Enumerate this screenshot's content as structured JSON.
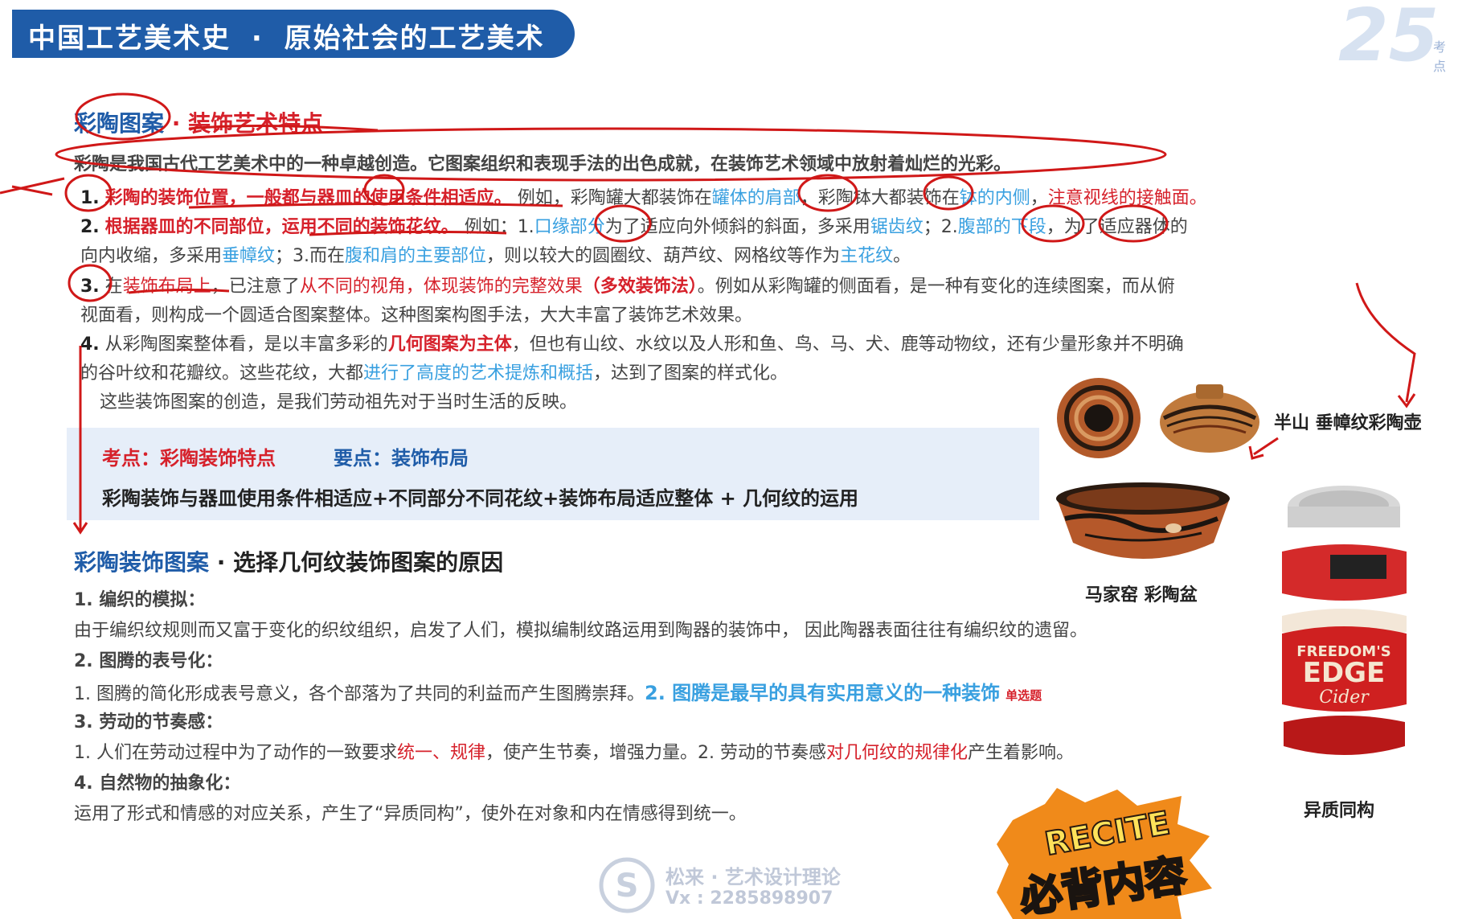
{
  "header": {
    "course": "中国工艺美术史",
    "separator": "·",
    "chapter": "原始社会的工艺美术",
    "logo_number": "25",
    "logo_sub": "考点"
  },
  "section1": {
    "title_a": "彩陶图案",
    "title_sep": "·",
    "title_b": "装饰艺术特点",
    "intro": "彩陶是我国古代工艺美术中的一种卓越创造。它图案组织和表现手法的出色成就，在装饰艺术领域中放射着灿烂的光彩。",
    "p1_num": "1.",
    "p1_red": "彩陶的装饰位置，一般都与器皿的使用条件相适应。",
    "p1_a": "例如，彩陶罐大都装饰在",
    "p1_b": "罐体的肩部",
    "p1_c": "，彩陶钵大都装饰在",
    "p1_d": "钵的内侧",
    "p1_e": "，",
    "p1_f": "注意视线的接触面。",
    "p2_num": "2.",
    "p2_red": "根据器皿的不同部位，运用不同的装饰花纹。",
    "p2_a": "例如：1.",
    "p2_b": "口缘部分",
    "p2_c": "为了适应向外倾斜的斜面，多采用",
    "p2_d": "锯齿纹",
    "p2_e": "；2.",
    "p2_f": "腹部的下段",
    "p2_g": "，为了适应器体的",
    "p2_h": "向内收缩，多采用",
    "p2_i": "垂幛纹",
    "p2_j": "；3.而在",
    "p2_k": "腹和肩的主要部位",
    "p2_l": "，则以较大的圆圈纹、葫芦纹、网格纹等作为",
    "p2_m": "主花纹",
    "p2_n": "。",
    "p3_num": "3.",
    "p3_a": "在",
    "p3_b": "装饰布局上",
    "p3_c": "，已注意了",
    "p3_d": "从不同的视角，体现装饰的完整效果",
    "p3_e": "（多效装饰法）",
    "p3_f": "。例如从彩陶罐的侧面看，是一种有变化的连续图案，而从俯",
    "p3_g": "视面看，则构成一个圆适合图案整体。这种图案构图手法，大大丰富了装饰艺术效果。",
    "p4_num": "4.",
    "p4_a": "从彩陶图案整体看，是以丰富多彩的",
    "p4_b": "几何图案为主体",
    "p4_c": "，但也有山纹、水纹以及人形和鱼、鸟、马、犬、鹿等动物纹，还有少量形象并不明确",
    "p4_d": "的谷叶纹和花瓣纹。这些花纹，大都",
    "p4_e": "进行了高度的艺术提炼和概括",
    "p4_f": "，达到了图案的样式化。",
    "p5": "这些装饰图案的创造，是我们劳动祖先对于当时生活的反映。"
  },
  "keybox": {
    "label1": "考点：彩陶装饰特点",
    "label2": "要点：装饰布局",
    "summary": "彩陶装饰与器皿使用条件相适应+不同部分不同花纹+装饰布局适应整体 + 几何纹的运用"
  },
  "section2": {
    "title_a": "彩陶装饰图案",
    "title_sep": "·",
    "title_b": "选择几何纹装饰图案的原因",
    "h1": "1. 编织的模拟：",
    "t1": "由于编织纹规则而又富于变化的织纹组织，启发了人们，模拟编制纹路运用到陶器的装饰中， 因此陶器表面往往有编织纹的遗留。",
    "h2": "2. 图腾的表号化：",
    "t2_a": "1. 图腾的简化形成表号意义，各个部落为了共同的利益而产生图腾崇拜。",
    "t2_b": "2. 图腾是最早的具有实用意义的一种装饰",
    "t2_c": "单选题",
    "h3": "3. 劳动的节奏感：",
    "t3_a": "1. 人们在劳动过程中为了动作的一致要求",
    "t3_b": "统一、规律",
    "t3_c": "，使产生节奏，增强力量。2. 劳动的节奏感",
    "t3_d": "对几何纹的规律化",
    "t3_e": "产生着影响。",
    "h4": "4. 自然物的抽象化：",
    "t4": "运用了形式和情感的对应关系，产生了“异质同构”，使外在对象和内在情感得到统一。"
  },
  "images": {
    "cap1": "半山 垂幛纹彩陶壶",
    "cap2": "马家窑 彩陶盆",
    "cap3": "异质同构",
    "can_text1": "FREEDOM'S",
    "can_text2": "EDGE",
    "can_text3": "Cider"
  },
  "badge": {
    "top": "RECITE",
    "bottom": "必背内容"
  },
  "watermark": {
    "line1": "松来 · 艺术设计理论",
    "line2": "Vx : 2285898907"
  },
  "colors": {
    "brand": "#1f5ca8",
    "red": "#d6212b",
    "highlight": "#39a0e0",
    "keybox": "#e6eef9"
  }
}
